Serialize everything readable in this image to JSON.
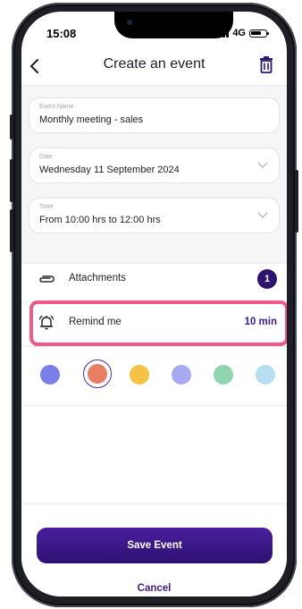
{
  "status_bar": {
    "time": "15:08",
    "network": "4G"
  },
  "header": {
    "title": "Create an event",
    "back_icon": "chevron-left-icon",
    "delete_icon": "trash-icon"
  },
  "form": {
    "event_name": {
      "label": "Event Name",
      "value": "Monthly meeting - sales"
    },
    "date": {
      "label": "Date",
      "value": "Wednesday 11 September 2024"
    },
    "time": {
      "label": "Time",
      "value": "From 10:00 hrs to 12:00 hrs"
    }
  },
  "attachments": {
    "label": "Attachments",
    "count": "1",
    "icon": "paperclip-icon"
  },
  "reminder": {
    "label": "Remind me",
    "value": "10 min",
    "icon": "bell-icon"
  },
  "colors": {
    "options": [
      "#7b7de8",
      "#e77f63",
      "#f4c244",
      "#a8a9f0",
      "#8fd6ae",
      "#b7dfef"
    ],
    "selected_index": 1,
    "highlight": "#ee5a8c",
    "accent": "#2e1470"
  },
  "actions": {
    "save_label": "Save Event",
    "cancel_label": "Cancel"
  }
}
